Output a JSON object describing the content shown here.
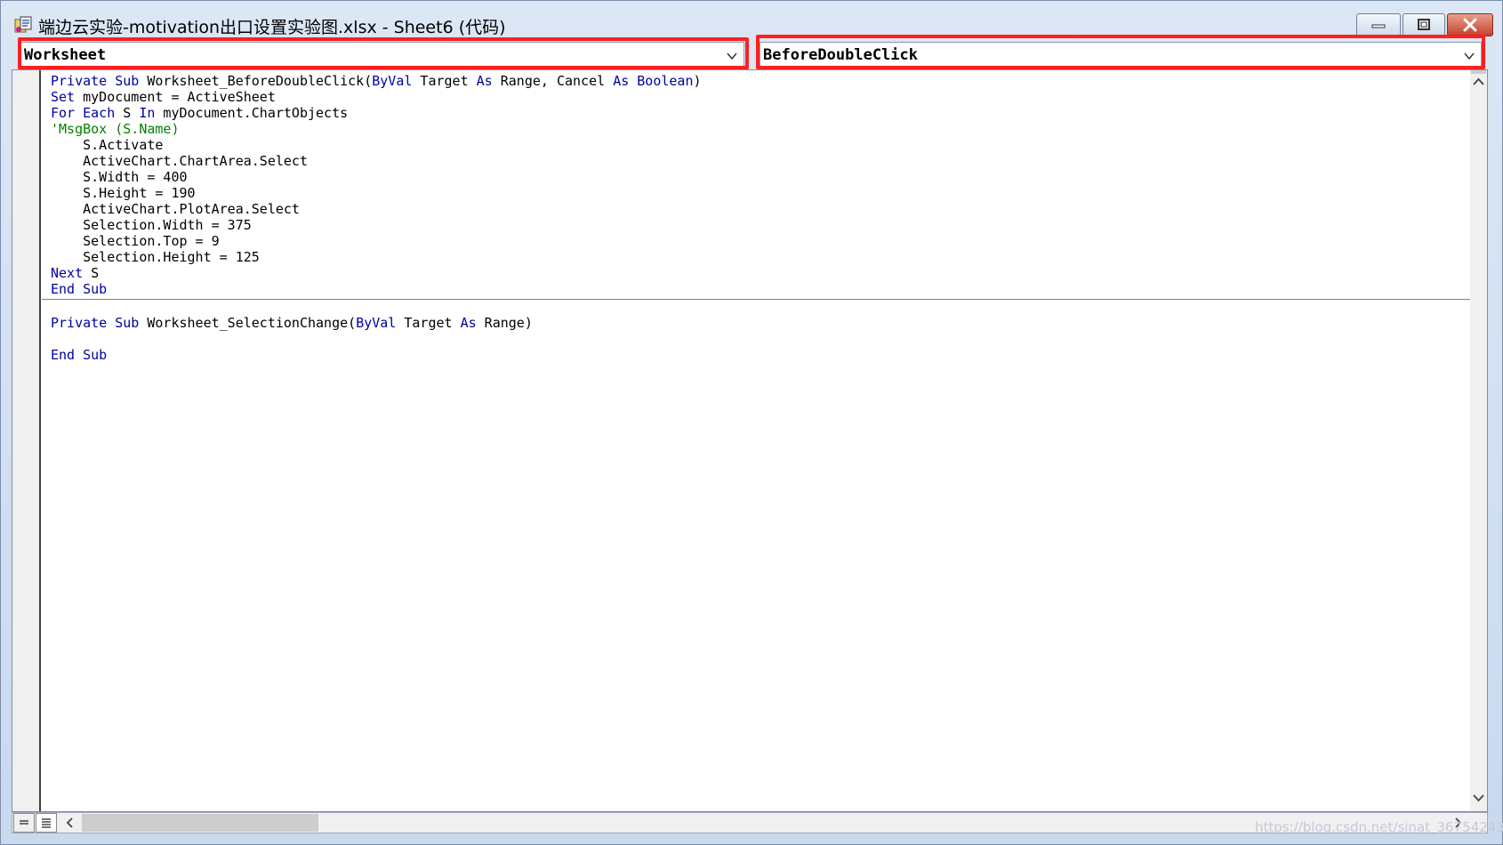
{
  "window": {
    "title": "端边云实验-motivation出口设置实验图.xlsx - Sheet6 (代码)"
  },
  "toolbar": {
    "object_combo_value": "Worksheet",
    "procedure_combo_value": "BeforeDoubleClick"
  },
  "code": {
    "block1": [
      [
        {
          "t": "Private Sub ",
          "k": "kw"
        },
        {
          "t": "Worksheet_BeforeDoubleClick(",
          "k": ""
        },
        {
          "t": "ByVal",
          "k": "kw"
        },
        {
          "t": " Target ",
          "k": ""
        },
        {
          "t": "As",
          "k": "kw"
        },
        {
          "t": " Range, Cancel ",
          "k": ""
        },
        {
          "t": "As",
          "k": "kw"
        },
        {
          "t": " ",
          "k": ""
        },
        {
          "t": "Boolean",
          "k": "kw"
        },
        {
          "t": ")",
          "k": ""
        }
      ],
      [
        {
          "t": "Set",
          "k": "kw"
        },
        {
          "t": " myDocument = ActiveSheet",
          "k": ""
        }
      ],
      [
        {
          "t": "For Each",
          "k": "kw"
        },
        {
          "t": " S ",
          "k": ""
        },
        {
          "t": "In",
          "k": "kw"
        },
        {
          "t": " myDocument.ChartObjects",
          "k": ""
        }
      ],
      [
        {
          "t": "'MsgBox (S.Name)",
          "k": "cm"
        }
      ],
      [
        {
          "t": "    S.Activate",
          "k": ""
        }
      ],
      [
        {
          "t": "    ActiveChart.ChartArea.Select",
          "k": ""
        }
      ],
      [
        {
          "t": "    S.Width = 400",
          "k": ""
        }
      ],
      [
        {
          "t": "    S.Height = 190",
          "k": ""
        }
      ],
      [
        {
          "t": "    ActiveChart.PlotArea.Select",
          "k": ""
        }
      ],
      [
        {
          "t": "    Selection.Width = 375",
          "k": ""
        }
      ],
      [
        {
          "t": "    Selection.Top = 9",
          "k": ""
        }
      ],
      [
        {
          "t": "    Selection.Height = 125",
          "k": ""
        }
      ],
      [
        {
          "t": "Next",
          "k": "kw"
        },
        {
          "t": " S",
          "k": ""
        }
      ],
      [
        {
          "t": "End Sub",
          "k": "kw"
        }
      ]
    ],
    "block2": [
      [
        {
          "t": "Private Sub ",
          "k": "kw"
        },
        {
          "t": "Worksheet_SelectionChange(",
          "k": ""
        },
        {
          "t": "ByVal",
          "k": "kw"
        },
        {
          "t": " Target ",
          "k": ""
        },
        {
          "t": "As",
          "k": "kw"
        },
        {
          "t": " Range)",
          "k": ""
        }
      ],
      [],
      [
        {
          "t": "End Sub",
          "k": "kw"
        }
      ]
    ]
  },
  "watermark": "https://blog.csdn.net/sinat_36754243",
  "colors": {
    "keyword": "#0000a0",
    "comment": "#008000",
    "highlight_box": "#ff2020"
  }
}
